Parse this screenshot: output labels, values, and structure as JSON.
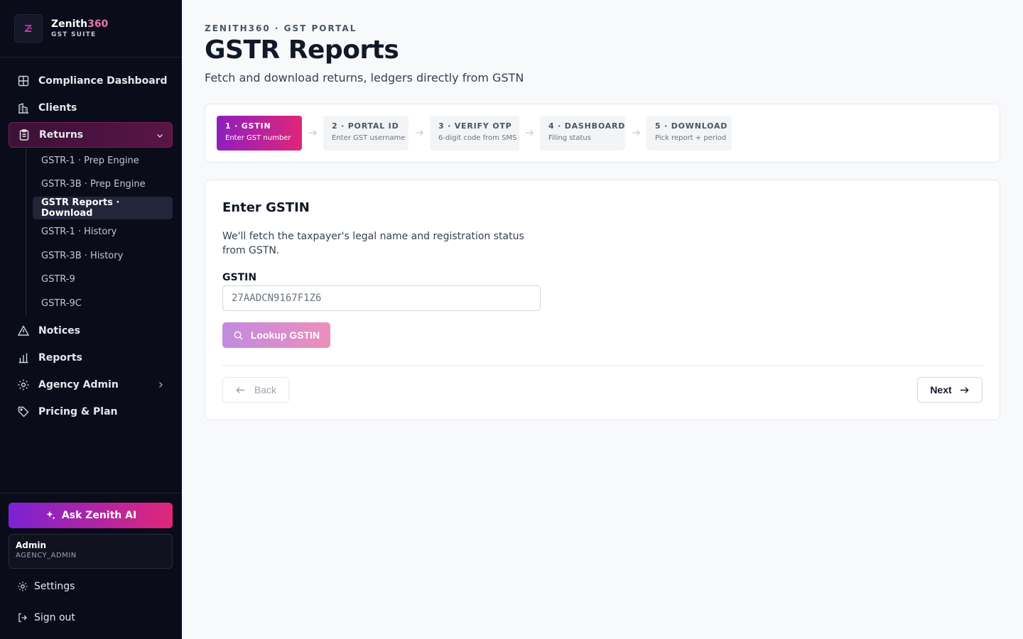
{
  "brand": {
    "name": "Zenith",
    "name_accent": "360",
    "subtitle": "GST SUITE"
  },
  "nav": {
    "compliance_dashboard": "Compliance Dashboard",
    "clients": "Clients",
    "returns": "Returns",
    "returns_sub": [
      "GSTR-1 · Prep Engine",
      "GSTR-3B · Prep Engine",
      "GSTR Reports · Download",
      "GSTR-1 · History",
      "GSTR-3B · History",
      "GSTR-9",
      "GSTR-9C"
    ],
    "notices": "Notices",
    "reports": "Reports",
    "agency_admin": "Agency Admin",
    "pricing_plan": "Pricing & Plan"
  },
  "sidebar_footer": {
    "ask_ai": "Ask Zenith AI",
    "user_name": "Admin",
    "user_role": "AGENCY_ADMIN",
    "settings": "Settings",
    "sign_out": "Sign out"
  },
  "header": {
    "eyebrow": "ZENITH360 · GST PORTAL",
    "title": "GSTR Reports",
    "subtitle": "Fetch and download returns, ledgers directly from GSTN"
  },
  "steps": [
    {
      "title": "1 · GSTIN",
      "desc": "Enter GST number"
    },
    {
      "title": "2 · PORTAL ID",
      "desc": "Enter GST username"
    },
    {
      "title": "3 · VERIFY OTP",
      "desc": "6-digit code from SMS"
    },
    {
      "title": "4 · DASHBOARD",
      "desc": "Filing status"
    },
    {
      "title": "5 · DOWNLOAD",
      "desc": "Pick report + period"
    }
  ],
  "form": {
    "title": "Enter GSTIN",
    "description": "We'll fetch the taxpayer's legal name and registration status from GSTN.",
    "gstin_label": "GSTIN",
    "gstin_placeholder": "27AADCN9167F1Z6",
    "gstin_value": "",
    "lookup_label": "Lookup GSTIN",
    "back_label": "Back",
    "next_label": "Next"
  },
  "colors": {
    "accent_start": "#8e1fbf",
    "accent_end": "#e0267a",
    "sidebar_bg": "#0b0c1a"
  }
}
